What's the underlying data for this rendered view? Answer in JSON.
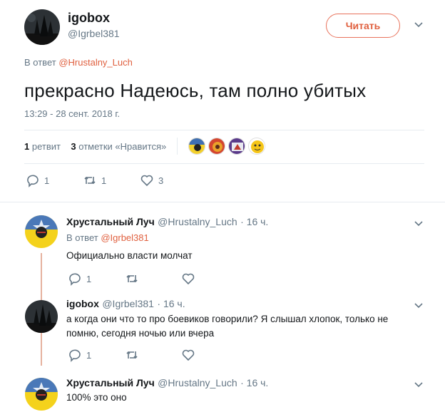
{
  "main_tweet": {
    "name": "igobox",
    "handle": "@Igrbel381",
    "follow_label": "Читать",
    "reply_prefix": "В ответ",
    "reply_to": "@Hrustalny_Luch",
    "text": "прекрасно Надеюсь, там полно убитых",
    "timestamp": "13:29 - 28 сент. 2018 г.",
    "retweet_count": "1",
    "retweet_label": "ретвит",
    "like_count": "3",
    "like_label": "отметки «Нравится»",
    "actions": {
      "reply": "1",
      "retweet": "1",
      "like": "3"
    }
  },
  "replies": [
    {
      "name": "Хрустальный Луч",
      "handle": "@Hrustalny_Luch",
      "time": "· 16 ч.",
      "reply_prefix": "В ответ",
      "reply_to": "@Igrbel381",
      "text": "Официально власти молчат",
      "reply_count": "1"
    },
    {
      "name": "igobox",
      "handle": "@Igrbel381",
      "time": "· 16 ч.",
      "text_line1": "а когда они что то про боевиков говорили? Я слышал хлопок, только не",
      "text_line2": "помню, сегодня ночью или вчера",
      "reply_count": "1"
    },
    {
      "name": "Хрустальный Луч",
      "handle": "@Hrustalny_Luch",
      "time": "· 16 ч.",
      "text": "100% это оно"
    }
  ],
  "colors": {
    "accent": "#e0603f",
    "muted": "#657786",
    "thread": "#e6b29f"
  }
}
